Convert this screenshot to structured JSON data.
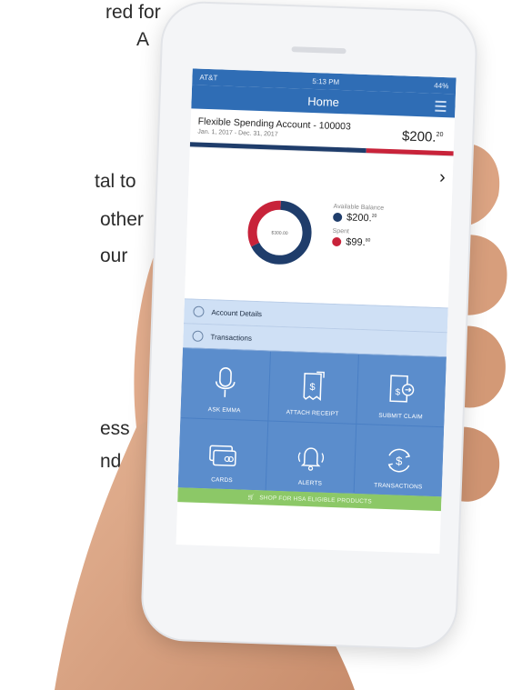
{
  "side_text": {
    "line1": "red for",
    "line2": "A",
    "line3": "tal to",
    "line4": "other",
    "line5": "our",
    "line6": "ess",
    "line7": "nd"
  },
  "status_bar": {
    "carrier": "AT&T",
    "time": "5:13 PM",
    "battery": "44%"
  },
  "nav": {
    "title": "Home"
  },
  "account": {
    "title": "Flexible Spending Account - 100003",
    "dates": "Jan. 1, 2017 - Dec. 31, 2017",
    "amount_main": "$200.",
    "amount_cents": "20",
    "available_fraction": 0.67,
    "spent_fraction": 0.33
  },
  "chart": {
    "center_label": "$300.00",
    "available_label": "Available Balance",
    "available_main": "$200.",
    "available_cents": "20",
    "spent_label": "Spent",
    "spent_main": "$99.",
    "spent_cents": "80"
  },
  "links": {
    "account_details": "Account Details",
    "transactions": "Transactions"
  },
  "tiles": [
    {
      "label": "ASK EMMA",
      "icon": "microphone-icon"
    },
    {
      "label": "ATTACH RECEIPT",
      "icon": "receipt-icon"
    },
    {
      "label": "SUBMIT CLAIM",
      "icon": "claim-icon"
    },
    {
      "label": "CARDS",
      "icon": "cards-icon"
    },
    {
      "label": "ALERTS",
      "icon": "bell-icon"
    },
    {
      "label": "TRANSACTIONS",
      "icon": "dollar-cycle-icon"
    }
  ],
  "shop_bar": {
    "label": "SHOP FOR HSA ELIGIBLE PRODUCTS"
  },
  "colors": {
    "header_blue": "#2f6db5",
    "navy": "#1f3d6b",
    "red": "#c8233a",
    "tile_blue": "#5b8dcc",
    "shop_green": "#8cc867"
  }
}
